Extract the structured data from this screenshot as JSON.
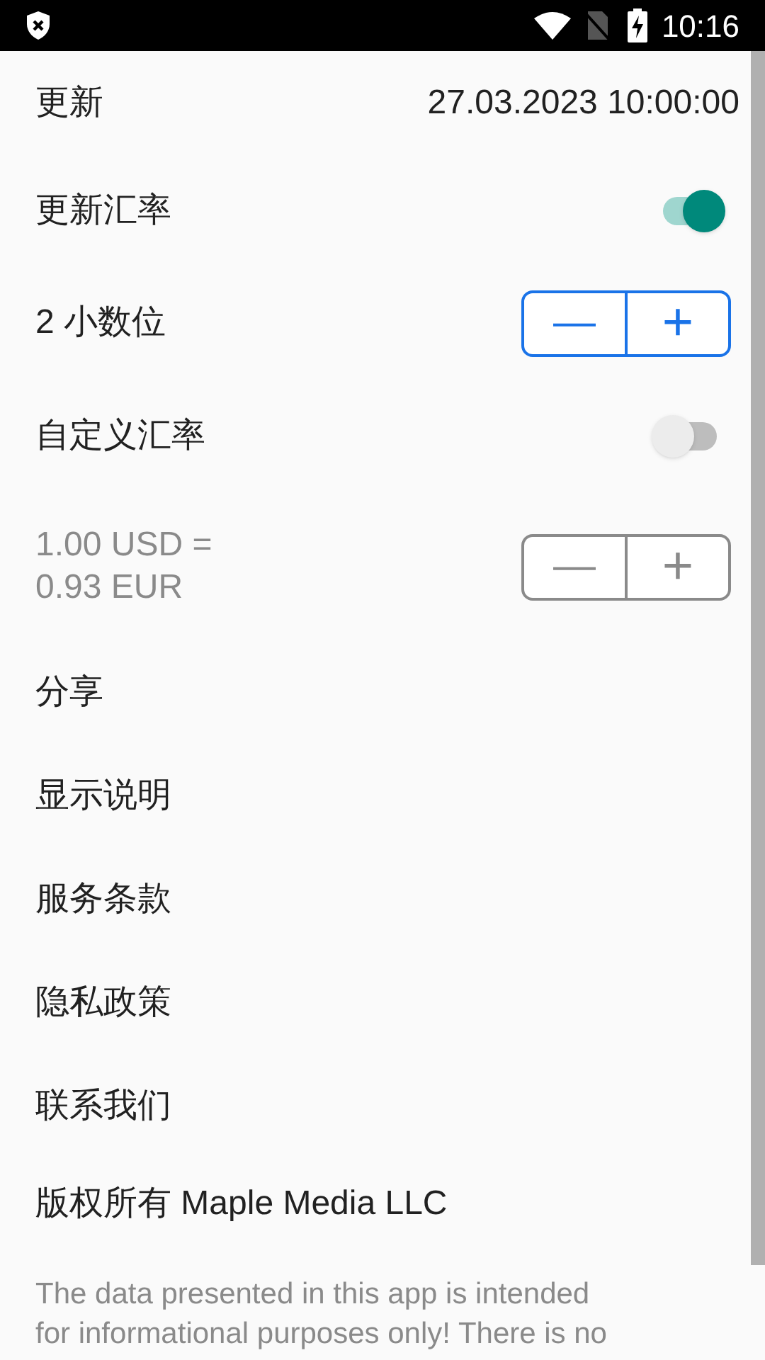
{
  "status_bar": {
    "time": "10:16"
  },
  "settings": [
    {
      "kind": "value",
      "label": "更新",
      "value": "27.03.2023 10:00:00"
    },
    {
      "kind": "toggle",
      "label": "更新汇率",
      "on": true
    },
    {
      "kind": "stepper",
      "label": "2 小数位",
      "disabled": false,
      "minus": "—",
      "plus": "+"
    },
    {
      "kind": "toggle",
      "label": "自定义汇率",
      "on": false
    },
    {
      "kind": "stepper",
      "label": "1.00 USD =\n0.93 EUR",
      "disabled": true,
      "minus": "—",
      "plus": "+"
    },
    {
      "kind": "link",
      "label": "分享"
    },
    {
      "kind": "link",
      "label": "显示说明"
    },
    {
      "kind": "link",
      "label": "服务条款"
    },
    {
      "kind": "link",
      "label": "隐私政策"
    },
    {
      "kind": "link",
      "label": "联系我们"
    },
    {
      "kind": "link",
      "label": "版权所有 Maple Media LLC"
    }
  ],
  "disclaimer_lines": [
    "The data presented in this app is intended",
    "for informational purposes only! There is no"
  ]
}
